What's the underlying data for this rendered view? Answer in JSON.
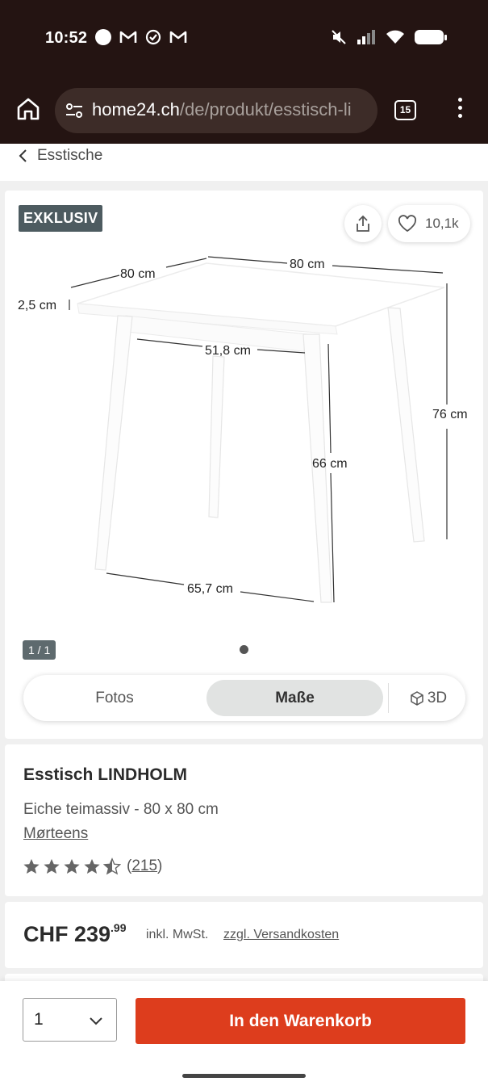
{
  "status_bar": {
    "time": "10:52",
    "icons_left": [
      "circle-icon",
      "gmail-icon",
      "check-icon",
      "gmail-icon"
    ],
    "icons_right": [
      "mute-icon",
      "signal-icon",
      "wifi-icon",
      "battery-icon"
    ]
  },
  "browser": {
    "url_host": "home24.ch",
    "url_path": "/de/produkt/esstisch-li",
    "tab_count": "15"
  },
  "breadcrumb": {
    "label": "Esstische"
  },
  "gallery": {
    "badge": "EXKLUSIV",
    "wishlist_count": "10,1k",
    "dimensions": {
      "top_left_width": "80 cm",
      "top_right_width": "80 cm",
      "top_thickness": "2,5 cm",
      "apron_width": "51,8 cm",
      "total_height": "76 cm",
      "leg_height": "66 cm",
      "floor_width": "65,7 cm"
    },
    "image_counter": "1 / 1",
    "tabs": {
      "fotos": "Fotos",
      "masse": "Maße",
      "three_d": "3D"
    }
  },
  "product": {
    "title": "Esstisch LINDHOLM",
    "subtitle": "Eiche teimassiv - 80 x 80 cm",
    "brand": "Mørteens",
    "rating_value": 4.5,
    "rating_count_open": "(",
    "rating_count": "215",
    "rating_count_close": ")"
  },
  "price": {
    "currency_amount": "CHF 239",
    "cents": ".99",
    "vat": "inkl. MwSt.",
    "shipping_link": "zzgl. Versandkosten"
  },
  "cart": {
    "quantity": "1",
    "button_label": "In den Warenkorb"
  },
  "colors": {
    "chrome_bg": "#241412",
    "cta_red": "#dd3d1d",
    "badge_gray": "#4d5b60",
    "segment_active": "#e1e3e2"
  }
}
